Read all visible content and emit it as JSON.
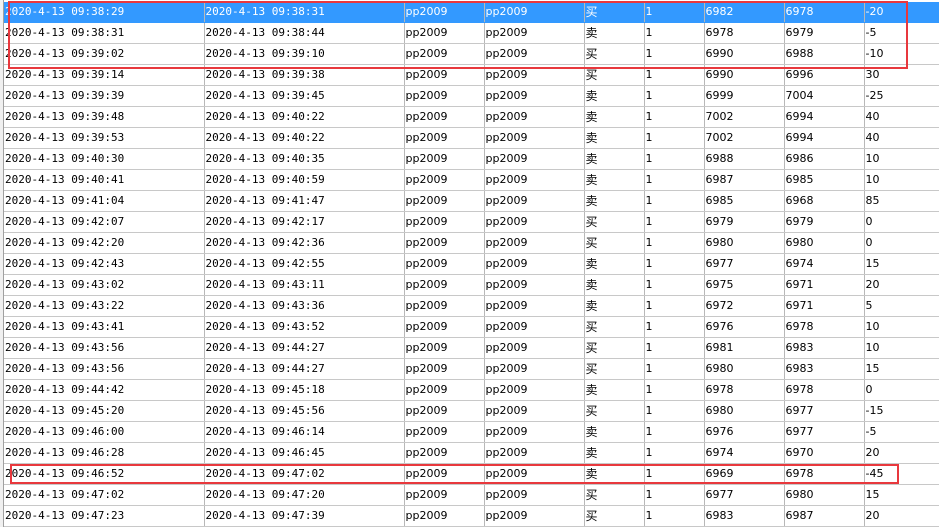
{
  "table": {
    "rows": [
      {
        "open_time": "2020-4-13 09:38:29",
        "close_time": "2020-4-13 09:38:31",
        "contract": "pp2009",
        "contract2": "pp2009",
        "side": "买",
        "qty": "1",
        "open_price": "6982",
        "close_price": "6978",
        "pnl": "-20",
        "selected": true
      },
      {
        "open_time": "2020-4-13 09:38:31",
        "close_time": "2020-4-13 09:38:44",
        "contract": "pp2009",
        "contract2": "pp2009",
        "side": "卖",
        "qty": "1",
        "open_price": "6978",
        "close_price": "6979",
        "pnl": "-5"
      },
      {
        "open_time": "2020-4-13 09:39:02",
        "close_time": "2020-4-13 09:39:10",
        "contract": "pp2009",
        "contract2": "pp2009",
        "side": "买",
        "qty": "1",
        "open_price": "6990",
        "close_price": "6988",
        "pnl": "-10"
      },
      {
        "open_time": "2020-4-13 09:39:14",
        "close_time": "2020-4-13 09:39:38",
        "contract": "pp2009",
        "contract2": "pp2009",
        "side": "买",
        "qty": "1",
        "open_price": "6990",
        "close_price": "6996",
        "pnl": "30"
      },
      {
        "open_time": "2020-4-13 09:39:39",
        "close_time": "2020-4-13 09:39:45",
        "contract": "pp2009",
        "contract2": "pp2009",
        "side": "卖",
        "qty": "1",
        "open_price": "6999",
        "close_price": "7004",
        "pnl": "-25"
      },
      {
        "open_time": "2020-4-13 09:39:48",
        "close_time": "2020-4-13 09:40:22",
        "contract": "pp2009",
        "contract2": "pp2009",
        "side": "卖",
        "qty": "1",
        "open_price": "7002",
        "close_price": "6994",
        "pnl": "40"
      },
      {
        "open_time": "2020-4-13 09:39:53",
        "close_time": "2020-4-13 09:40:22",
        "contract": "pp2009",
        "contract2": "pp2009",
        "side": "卖",
        "qty": "1",
        "open_price": "7002",
        "close_price": "6994",
        "pnl": "40"
      },
      {
        "open_time": "2020-4-13 09:40:30",
        "close_time": "2020-4-13 09:40:35",
        "contract": "pp2009",
        "contract2": "pp2009",
        "side": "卖",
        "qty": "1",
        "open_price": "6988",
        "close_price": "6986",
        "pnl": "10"
      },
      {
        "open_time": "2020-4-13 09:40:41",
        "close_time": "2020-4-13 09:40:59",
        "contract": "pp2009",
        "contract2": "pp2009",
        "side": "卖",
        "qty": "1",
        "open_price": "6987",
        "close_price": "6985",
        "pnl": "10"
      },
      {
        "open_time": "2020-4-13 09:41:04",
        "close_time": "2020-4-13 09:41:47",
        "contract": "pp2009",
        "contract2": "pp2009",
        "side": "卖",
        "qty": "1",
        "open_price": "6985",
        "close_price": "6968",
        "pnl": "85"
      },
      {
        "open_time": "2020-4-13 09:42:07",
        "close_time": "2020-4-13 09:42:17",
        "contract": "pp2009",
        "contract2": "pp2009",
        "side": "买",
        "qty": "1",
        "open_price": "6979",
        "close_price": "6979",
        "pnl": "0"
      },
      {
        "open_time": "2020-4-13 09:42:20",
        "close_time": "2020-4-13 09:42:36",
        "contract": "pp2009",
        "contract2": "pp2009",
        "side": "买",
        "qty": "1",
        "open_price": "6980",
        "close_price": "6980",
        "pnl": "0"
      },
      {
        "open_time": "2020-4-13 09:42:43",
        "close_time": "2020-4-13 09:42:55",
        "contract": "pp2009",
        "contract2": "pp2009",
        "side": "卖",
        "qty": "1",
        "open_price": "6977",
        "close_price": "6974",
        "pnl": "15"
      },
      {
        "open_time": "2020-4-13 09:43:02",
        "close_time": "2020-4-13 09:43:11",
        "contract": "pp2009",
        "contract2": "pp2009",
        "side": "卖",
        "qty": "1",
        "open_price": "6975",
        "close_price": "6971",
        "pnl": "20"
      },
      {
        "open_time": "2020-4-13 09:43:22",
        "close_time": "2020-4-13 09:43:36",
        "contract": "pp2009",
        "contract2": "pp2009",
        "side": "卖",
        "qty": "1",
        "open_price": "6972",
        "close_price": "6971",
        "pnl": "5"
      },
      {
        "open_time": "2020-4-13 09:43:41",
        "close_time": "2020-4-13 09:43:52",
        "contract": "pp2009",
        "contract2": "pp2009",
        "side": "买",
        "qty": "1",
        "open_price": "6976",
        "close_price": "6978",
        "pnl": "10"
      },
      {
        "open_time": "2020-4-13 09:43:56",
        "close_time": "2020-4-13 09:44:27",
        "contract": "pp2009",
        "contract2": "pp2009",
        "side": "买",
        "qty": "1",
        "open_price": "6981",
        "close_price": "6983",
        "pnl": "10"
      },
      {
        "open_time": "2020-4-13 09:43:56",
        "close_time": "2020-4-13 09:44:27",
        "contract": "pp2009",
        "contract2": "pp2009",
        "side": "买",
        "qty": "1",
        "open_price": "6980",
        "close_price": "6983",
        "pnl": "15"
      },
      {
        "open_time": "2020-4-13 09:44:42",
        "close_time": "2020-4-13 09:45:18",
        "contract": "pp2009",
        "contract2": "pp2009",
        "side": "卖",
        "qty": "1",
        "open_price": "6978",
        "close_price": "6978",
        "pnl": "0"
      },
      {
        "open_time": "2020-4-13 09:45:20",
        "close_time": "2020-4-13 09:45:56",
        "contract": "pp2009",
        "contract2": "pp2009",
        "side": "买",
        "qty": "1",
        "open_price": "6980",
        "close_price": "6977",
        "pnl": "-15"
      },
      {
        "open_time": "2020-4-13 09:46:00",
        "close_time": "2020-4-13 09:46:14",
        "contract": "pp2009",
        "contract2": "pp2009",
        "side": "卖",
        "qty": "1",
        "open_price": "6976",
        "close_price": "6977",
        "pnl": "-5"
      },
      {
        "open_time": "2020-4-13 09:46:28",
        "close_time": "2020-4-13 09:46:45",
        "contract": "pp2009",
        "contract2": "pp2009",
        "side": "卖",
        "qty": "1",
        "open_price": "6974",
        "close_price": "6970",
        "pnl": "20"
      },
      {
        "open_time": "2020-4-13 09:46:52",
        "close_time": "2020-4-13 09:47:02",
        "contract": "pp2009",
        "contract2": "pp2009",
        "side": "卖",
        "qty": "1",
        "open_price": "6969",
        "close_price": "6978",
        "pnl": "-45"
      },
      {
        "open_time": "2020-4-13 09:47:02",
        "close_time": "2020-4-13 09:47:20",
        "contract": "pp2009",
        "contract2": "pp2009",
        "side": "买",
        "qty": "1",
        "open_price": "6977",
        "close_price": "6980",
        "pnl": "15"
      },
      {
        "open_time": "2020-4-13 09:47:23",
        "close_time": "2020-4-13 09:47:39",
        "contract": "pp2009",
        "contract2": "pp2009",
        "side": "买",
        "qty": "1",
        "open_price": "6983",
        "close_price": "6987",
        "pnl": "20"
      }
    ]
  },
  "colors": {
    "selection": "#3399ff",
    "highlight_box": "#e8383d",
    "grid_line": "#c8c8c8"
  }
}
